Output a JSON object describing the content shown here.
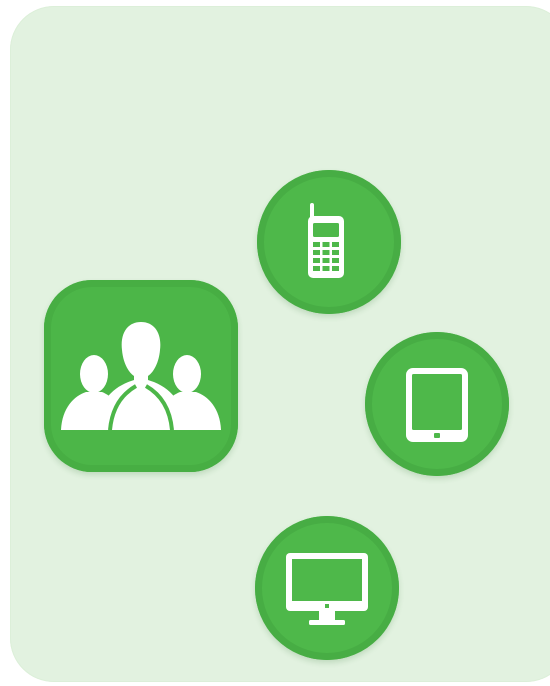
{
  "illustration": {
    "background_color": "#e2f2e0",
    "accent_color": "#4cb648",
    "icon_color": "#ffffff",
    "items": [
      {
        "icon": "user-group-icon"
      },
      {
        "icon": "mobile-phone-icon"
      },
      {
        "icon": "tablet-icon"
      },
      {
        "icon": "desktop-monitor-icon"
      }
    ]
  }
}
